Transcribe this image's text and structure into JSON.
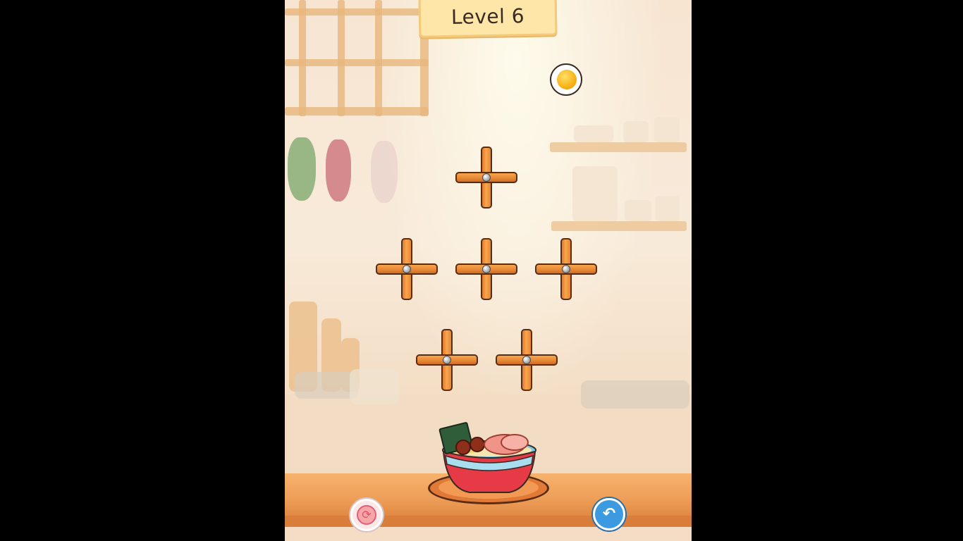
{
  "level": {
    "label": "Level 6"
  },
  "coin": {
    "icon": "egg-yolk-coin-icon"
  },
  "pins": [
    {
      "name": "cross-pin-top"
    },
    {
      "name": "cross-pin-row2-left"
    },
    {
      "name": "cross-pin-row2-center"
    },
    {
      "name": "cross-pin-row2-right"
    },
    {
      "name": "cross-pin-row3-left"
    },
    {
      "name": "cross-pin-row3-right"
    }
  ],
  "bowl": {
    "icon": "ramen-bowl-icon"
  },
  "controls": {
    "restart": {
      "icon": "restart-icon",
      "glyph": "⟳"
    },
    "undo": {
      "icon": "undo-arrow-icon",
      "glyph": "↶"
    }
  },
  "colors": {
    "wood": "#f0a04f",
    "wood_outline": "#5a2c14",
    "banner": "#fde6a7",
    "undo_button": "#3c9be0",
    "restart_button": "#f6a6a6"
  }
}
